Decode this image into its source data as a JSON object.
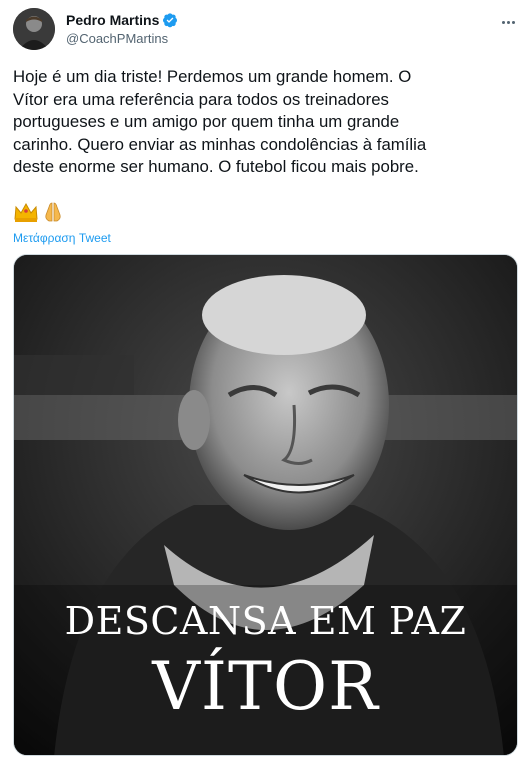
{
  "author": {
    "name": "Pedro Martins",
    "handle": "@CoachPMartins"
  },
  "tweet": {
    "text": "Hoje é um dia triste! Perdemos um grande homem. O\nVítor era uma referência para todos os treinadores\nportugueses e um amigo por quem tinha um grande\ncarinho. Quero enviar as minhas condolências à família\ndeste enorme ser humano. O futebol ficou mais pobre.",
    "emojis": [
      "crown-emoji",
      "folded-hands-emoji"
    ],
    "translate_label": "Μετάφραση Tweet"
  },
  "media": {
    "line1": "DESCANSA EM PAZ",
    "line2": "VÍTOR"
  },
  "colors": {
    "link": "#1d9bf0",
    "verified": "#1d9bf0",
    "secondary_text": "#536471"
  }
}
